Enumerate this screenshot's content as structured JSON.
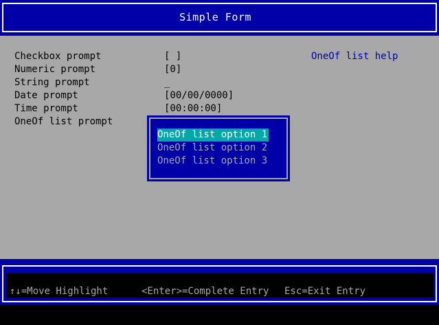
{
  "header": {
    "title": "Simple Form"
  },
  "form": {
    "rows": [
      {
        "prompt": "Checkbox prompt",
        "value": "[ ]"
      },
      {
        "prompt": "Numeric prompt",
        "value": "[0]"
      },
      {
        "prompt": "String prompt",
        "value": "_"
      },
      {
        "prompt": "Date prompt",
        "value": "[00/00/0000]"
      },
      {
        "prompt": "Time prompt",
        "value": "[00:00:00]"
      },
      {
        "prompt": "OneOf list prompt",
        "value": ""
      }
    ],
    "help_text": "OneOf list help"
  },
  "popup": {
    "options": [
      {
        "label": "OneOf list option 1",
        "selected": true
      },
      {
        "label": "OneOf list option 2",
        "selected": false
      },
      {
        "label": "OneOf list option 3",
        "selected": false
      }
    ]
  },
  "footer": {
    "move_hint": "↑↓=Move Highlight",
    "enter_hint": "<Enter>=Complete Entry",
    "esc_hint": "Esc=Exit Entry"
  },
  "colors": {
    "bios_blue": "#0000a8",
    "bios_gray": "#a8a8a8",
    "highlight_cyan": "#00a8a8",
    "frame_white": "#ffffff"
  }
}
